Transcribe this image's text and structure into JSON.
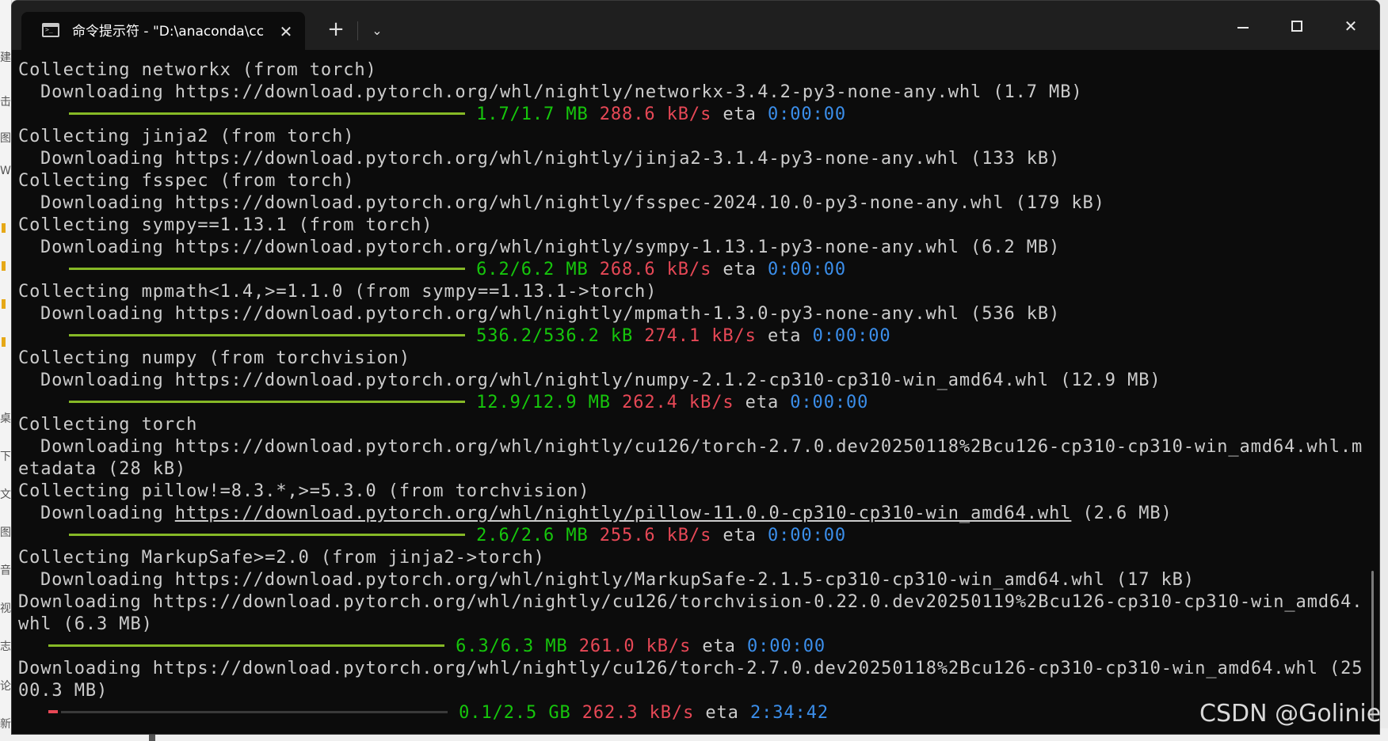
{
  "background": {
    "strip_glyphs": [
      "建",
      "击",
      "图",
      "W",
      "桌",
      "下",
      "文",
      "图",
      "音",
      "视",
      "志",
      "论",
      "新"
    ]
  },
  "window": {
    "tab_title": "命令提示符 - \"D:\\anaconda\\cc",
    "close_tab": "✕",
    "new_tab": "+",
    "dropdown": "⌄",
    "close_window": "✕"
  },
  "console": {
    "l1": "Collecting networkx (from torch)",
    "l2": "Downloading https://download.pytorch.org/whl/nightly/networkx-3.4.2-py3-none-any.whl (1.7 MB)",
    "p1": {
      "size": "1.7/1.7 MB",
      "speed": "288.6 kB/s",
      "eta_label": "eta",
      "eta": "0:00:00"
    },
    "l3": "Collecting jinja2 (from torch)",
    "l4": "Downloading https://download.pytorch.org/whl/nightly/jinja2-3.1.4-py3-none-any.whl (133 kB)",
    "l5": "Collecting fsspec (from torch)",
    "l6": "Downloading https://download.pytorch.org/whl/nightly/fsspec-2024.10.0-py3-none-any.whl (179 kB)",
    "l7": "Collecting sympy==1.13.1 (from torch)",
    "l8": "Downloading https://download.pytorch.org/whl/nightly/sympy-1.13.1-py3-none-any.whl (6.2 MB)",
    "p2": {
      "size": "6.2/6.2 MB",
      "speed": "268.6 kB/s",
      "eta_label": "eta",
      "eta": "0:00:00"
    },
    "l9": "Collecting mpmath<1.4,>=1.1.0 (from sympy==1.13.1->torch)",
    "l10": "Downloading https://download.pytorch.org/whl/nightly/mpmath-1.3.0-py3-none-any.whl (536 kB)",
    "p3": {
      "size": "536.2/536.2 kB",
      "speed": "274.1 kB/s",
      "eta_label": "eta",
      "eta": "0:00:00"
    },
    "l11": "Collecting numpy (from torchvision)",
    "l12": "Downloading https://download.pytorch.org/whl/nightly/numpy-2.1.2-cp310-cp310-win_amd64.whl (12.9 MB)",
    "p4": {
      "size": "12.9/12.9 MB",
      "speed": "262.4 kB/s",
      "eta_label": "eta",
      "eta": "0:00:00"
    },
    "l13": "Collecting torch",
    "l14": "Downloading https://download.pytorch.org/whl/nightly/cu126/torch-2.7.0.dev20250118%2Bcu126-cp310-cp310-win_amd64.whl.m",
    "l14b": "etadata (28 kB)",
    "l15": "Collecting pillow!=8.3.*,>=5.3.0 (from torchvision)",
    "l16_prefix": "Downloading",
    "l16_url": "https://download.pytorch.org/whl/nightly/pillow-11.0.0-cp310-cp310-win_amd64.whl",
    "l16_size": "(2.6 MB)",
    "p5": {
      "size": "2.6/2.6 MB",
      "speed": "255.6 kB/s",
      "eta_label": "eta",
      "eta": "0:00:00"
    },
    "l17": "Collecting MarkupSafe>=2.0 (from jinja2->torch)",
    "l18": "Downloading https://download.pytorch.org/whl/nightly/MarkupSafe-2.1.5-cp310-cp310-win_amd64.whl (17 kB)",
    "l19": "Downloading https://download.pytorch.org/whl/nightly/cu126/torchvision-0.22.0.dev20250119%2Bcu126-cp310-cp310-win_amd64.",
    "l19b": "whl (6.3 MB)",
    "p6": {
      "size": "6.3/6.3 MB",
      "speed": "261.0 kB/s",
      "eta_label": "eta",
      "eta": "0:00:00"
    },
    "l20": "Downloading https://download.pytorch.org/whl/nightly/cu126/torch-2.7.0.dev20250118%2Bcu126-cp310-cp310-win_amd64.whl (25",
    "l20b": "00.3 MB)",
    "p7": {
      "size": "0.1/2.5 GB",
      "speed": "262.3 kB/s",
      "eta_label": "eta",
      "eta": "2:34:42",
      "progress_fraction": 0.04
    }
  },
  "watermark": "CSDN @Golinie",
  "colors": {
    "bar_done": "#86b926",
    "bar_active": "#e74856",
    "size_text": "#16c60c",
    "speed_text": "#e74856",
    "eta_text": "#3b8eea"
  }
}
